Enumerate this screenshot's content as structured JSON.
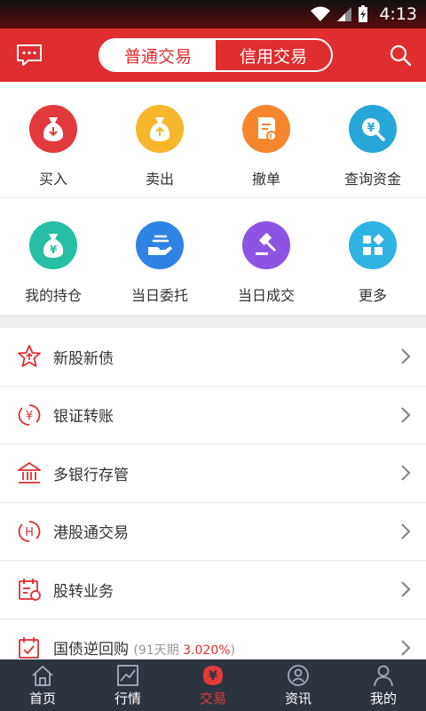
{
  "status_bar": {
    "time": "4:13"
  },
  "header": {
    "segments": [
      {
        "label": "普通交易",
        "active": true
      },
      {
        "label": "信用交易",
        "active": false
      }
    ]
  },
  "quick_actions": [
    {
      "label": "买入",
      "icon": "money-bag-down-icon",
      "color": "#e23a3c"
    },
    {
      "label": "卖出",
      "icon": "money-bag-up-icon",
      "color": "#f7b72c"
    },
    {
      "label": "撤单",
      "icon": "cancel-order-icon",
      "color": "#f6862c"
    },
    {
      "label": "查询资金",
      "icon": "fund-query-icon",
      "color": "#26a7d8"
    },
    {
      "label": "我的持仓",
      "icon": "holdings-icon",
      "color": "#27bfa4"
    },
    {
      "label": "当日委托",
      "icon": "entrust-icon",
      "color": "#2f83e4"
    },
    {
      "label": "当日成交",
      "icon": "gavel-icon",
      "color": "#8c54e3"
    },
    {
      "label": "更多",
      "icon": "more-apps-icon",
      "color": "#2eb3e3"
    }
  ],
  "menu": [
    {
      "label": "新股新债",
      "icon": "star-up-icon"
    },
    {
      "label": "银证转账",
      "icon": "yuan-transfer-icon"
    },
    {
      "label": "多银行存管",
      "icon": "bank-icon"
    },
    {
      "label": "港股通交易",
      "icon": "hk-icon"
    },
    {
      "label": "股转业务",
      "icon": "calendar-icon"
    },
    {
      "label": "国债逆回购",
      "icon": "calendar-check-icon",
      "sub_prefix": "(91天期 ",
      "sub_highlight": "3.020%",
      "sub_suffix": ")"
    }
  ],
  "tabbar": [
    {
      "label": "首页",
      "icon": "home-icon",
      "active": false
    },
    {
      "label": "行情",
      "icon": "chart-icon",
      "active": false
    },
    {
      "label": "交易",
      "icon": "trade-icon",
      "active": true
    },
    {
      "label": "资讯",
      "icon": "news-icon",
      "active": false
    },
    {
      "label": "我的",
      "icon": "user-icon",
      "active": false
    }
  ],
  "colors": {
    "brand": "#e02d2f",
    "tabbar_bg": "#2c3440"
  }
}
